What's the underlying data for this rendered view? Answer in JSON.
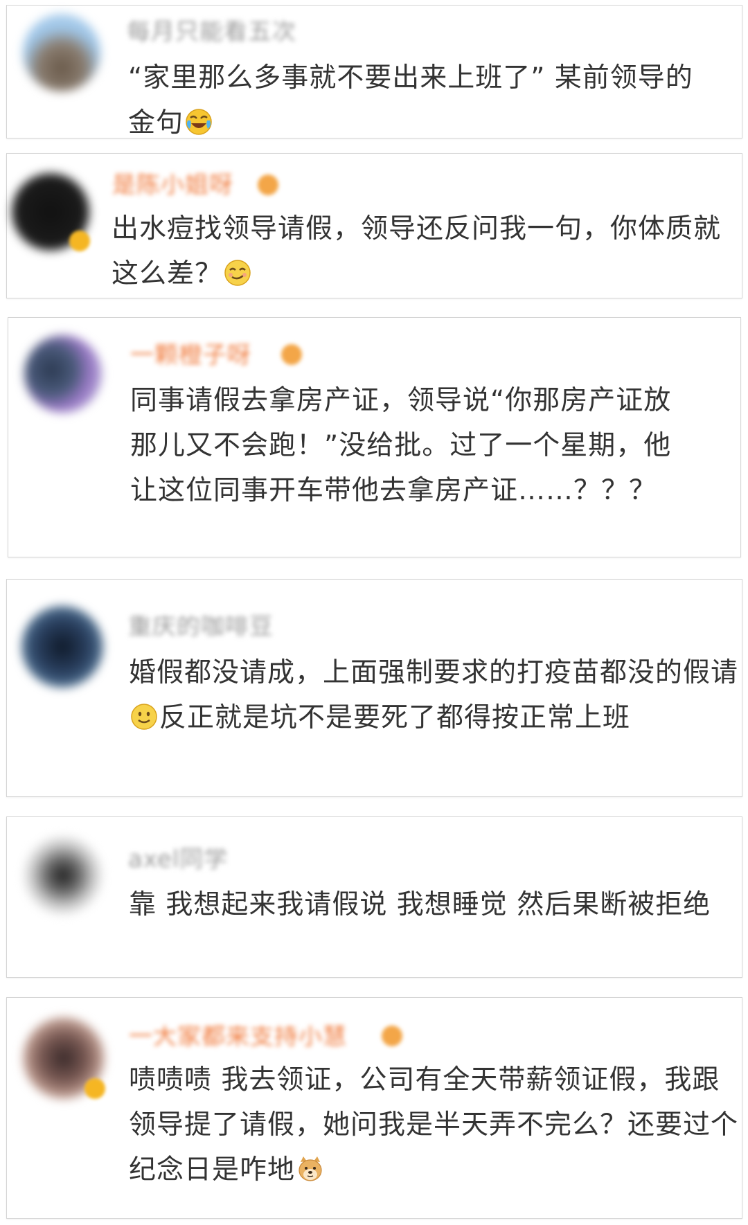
{
  "comments": [
    {
      "username": "每月只能看五次",
      "text": "“家里那么多事就不要出来上班了” 某前领导的金句",
      "emoji": "laugh-cry-emoji"
    },
    {
      "username": "是陈小姐呀",
      "text": "出水痘找领导请假，领导还反问我一句，你体质就这么差？",
      "emoji": "smirk-emoji"
    },
    {
      "username": "一颗橙子呀",
      "text": "同事请假去拿房产证，领导说“你那房产证放那儿又不会跑！”没给批。过了一个星期，他让这位同事开车带他去拿房产证……？？？"
    },
    {
      "username": "重庆的咖啡豆",
      "text_before": "婚假都没请成，上面强制要求的打疫苗都没的假请",
      "text_after": "反正就是坑不是要死了都得按正常上班",
      "emoji": "smile-emoji"
    },
    {
      "username": "axel同学",
      "text": "靠 我想起来我请假说 我想睡觉 然后果断被拒绝"
    },
    {
      "username": "一大家都来支持小慧",
      "text": "啧啧啧 我去领证，公司有全天带薪领证假，我跟领导提了请假，她问我是半天弄不完么？还要过个纪念日是咋地",
      "emoji": "doge-emoji"
    }
  ],
  "colors": {
    "text": "#333333",
    "border": "#d5d5d5",
    "username_gray": "#9a9a9a",
    "username_vip": "#f07a3c",
    "badge": "#f5b623"
  }
}
